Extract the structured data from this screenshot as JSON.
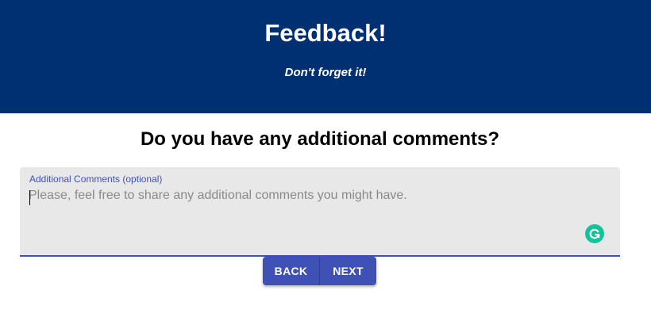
{
  "header": {
    "title": "Feedback!",
    "subtitle": "Don't forget it!",
    "background_color": "#003072"
  },
  "question": {
    "text": "Do you have any additional comments?"
  },
  "comments_field": {
    "label": "Additional Comments (optional)",
    "value": "",
    "placeholder": "Please, feel free to share any additional comments you might have.",
    "accent_color": "#3f51b5",
    "extension_icon": "grammarly-icon"
  },
  "navigation": {
    "back_label": "BACK",
    "next_label": "NEXT",
    "button_color": "#3f51b5"
  }
}
